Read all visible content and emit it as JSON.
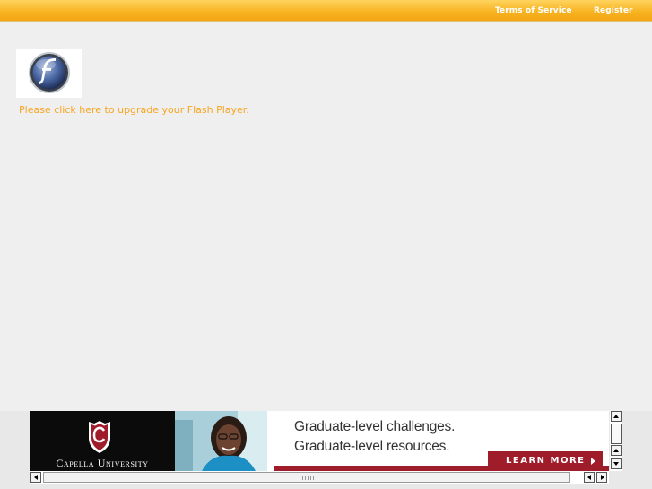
{
  "header": {
    "terms_label": "Terms of Service",
    "register_label": "Register",
    "bar_color": "#f7b21f"
  },
  "main": {
    "upgrade_text": "Please click here to upgrade your Flash Player.",
    "link_color": "#f7a622",
    "flash_icon": "flash-player-icon"
  },
  "ad": {
    "brand": "Capella University",
    "headline_1": "Graduate-level challenges.",
    "headline_2": "Graduate-level resources.",
    "cta_label": "LEARN MORE",
    "accent_color": "#9f1d2b"
  }
}
